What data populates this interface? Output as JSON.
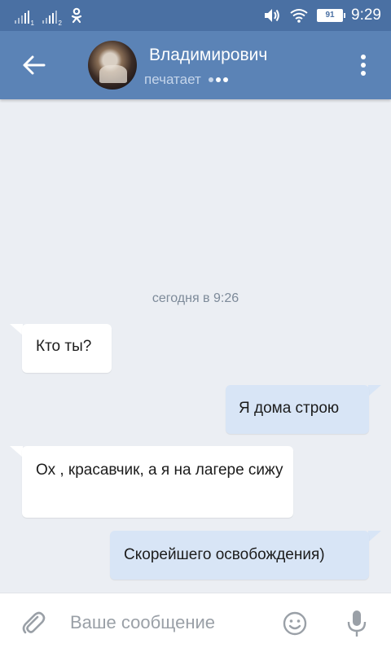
{
  "status_bar": {
    "battery": "91",
    "time": "9:29",
    "sim1_label": "1",
    "sim2_label": "2",
    "icons": [
      "signal-sim1-icon",
      "signal-sim2-icon",
      "odnoklassniki-icon",
      "volume-icon",
      "wifi-icon",
      "battery-icon"
    ]
  },
  "header": {
    "contact_name": "Владимирович",
    "status": "печатает",
    "icons": [
      "back-arrow-icon",
      "avatar",
      "more-vertical-icon"
    ]
  },
  "chat": {
    "date_separator": "сегодня в 9:26",
    "messages": [
      {
        "direction": "in",
        "text": "Кто ты?"
      },
      {
        "direction": "out",
        "text": "Я дома строю"
      },
      {
        "direction": "in",
        "text": "Ох , красавчик, а я на лагере сижу"
      },
      {
        "direction": "out",
        "text": "Скорейшего освобождения)"
      }
    ]
  },
  "composer": {
    "placeholder": "Ваше сообщение",
    "value": "",
    "icons": [
      "paperclip-icon",
      "emoji-icon",
      "microphone-icon"
    ]
  },
  "colors": {
    "status_bar": "#4a70a3",
    "app_bar": "#5b83b6",
    "background": "#ebeef3",
    "incoming_bubble": "#ffffff",
    "outgoing_bubble": "#d8e5f6"
  }
}
